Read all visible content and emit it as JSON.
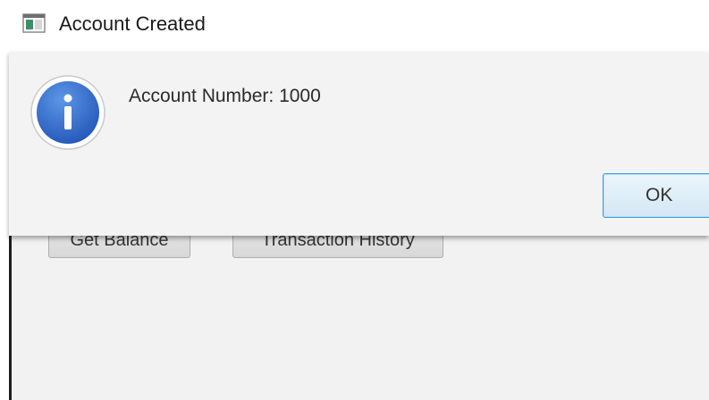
{
  "dialog": {
    "title": "Account Created",
    "message": "Account Number: 1000",
    "ok_label": "OK",
    "icon": "info-icon"
  },
  "background_window": {
    "buttons": [
      {
        "label": "Get Balance"
      },
      {
        "label": "Transaction History"
      }
    ]
  },
  "colors": {
    "info_icon_blue": "#2f6fd0",
    "ok_button_border": "#3c9ad8",
    "dialog_background": "#f3f3f3"
  }
}
